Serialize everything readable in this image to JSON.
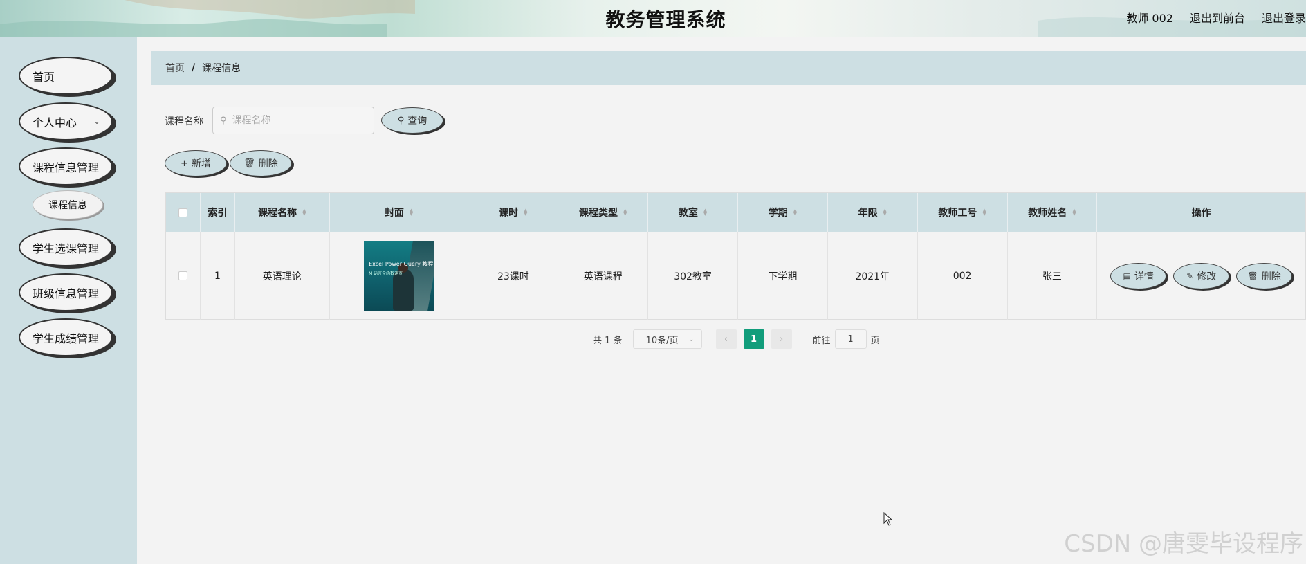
{
  "header": {
    "title": "教务管理系统",
    "user": "教师 002",
    "to_front": "退出到前台",
    "logout": "退出登录"
  },
  "sidebar": {
    "items": [
      {
        "label": "首页"
      },
      {
        "label": "个人中心"
      },
      {
        "label": "课程信息管理"
      },
      {
        "label": "学生选课管理"
      },
      {
        "label": "班级信息管理"
      },
      {
        "label": "学生成绩管理"
      }
    ],
    "sub_item": "课程信息"
  },
  "breadcrumb": {
    "home": "首页",
    "separator": "/",
    "current": "课程信息"
  },
  "search": {
    "label": "课程名称",
    "placeholder": "课程名称",
    "button": "查询"
  },
  "actions": {
    "add": "新增",
    "delete": "删除"
  },
  "table": {
    "columns": [
      "索引",
      "课程名称",
      "封面",
      "课时",
      "课程类型",
      "教室",
      "学期",
      "年限",
      "教师工号",
      "教师姓名",
      "操作"
    ],
    "rows": [
      {
        "index": "1",
        "course_name": "英语理论",
        "cover_title": "Excel Power Query 教程",
        "cover_subtitle": "M 语言全函数速查",
        "hours": "23课时",
        "course_type": "英语课程",
        "classroom": "302教室",
        "semester": "下学期",
        "year": "2021年",
        "teacher_id": "002",
        "teacher_name": "张三",
        "ops": {
          "detail": "详情",
          "edit": "修改",
          "delete": "删除"
        }
      }
    ]
  },
  "pagination": {
    "total": "共 1 条",
    "page_size": "10条/页",
    "current_page": "1",
    "goto_label": "前往",
    "goto_value": "1",
    "page_suffix": "页"
  },
  "watermark": "CSDN @唐雯毕设程序",
  "colors": {
    "accent": "#cddfe3",
    "active_page": "#119d7b"
  }
}
